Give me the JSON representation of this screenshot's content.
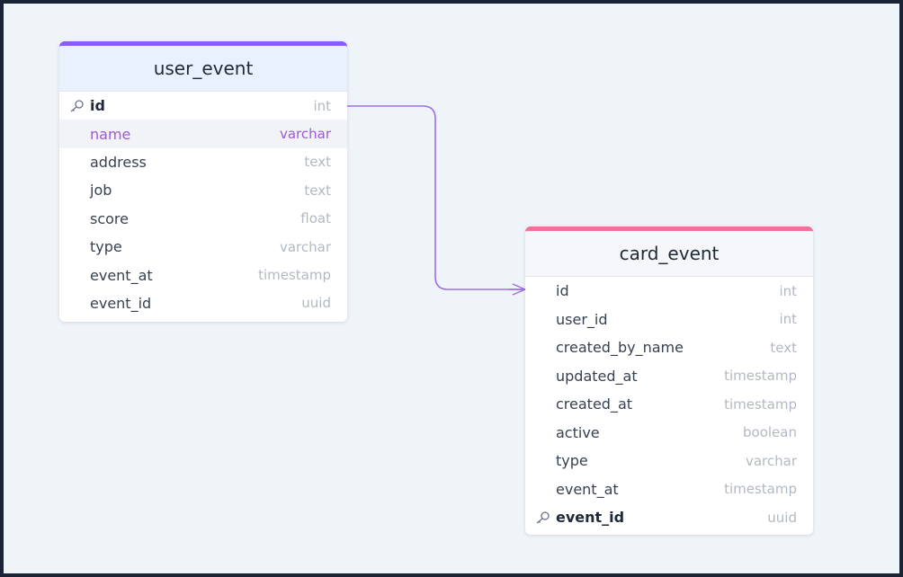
{
  "tables": [
    {
      "name": "user_event",
      "header_color": "#8b5cf6",
      "columns": [
        {
          "name": "id",
          "type": "int",
          "primary_key": true
        },
        {
          "name": "name",
          "type": "varchar",
          "highlighted": true
        },
        {
          "name": "address",
          "type": "text"
        },
        {
          "name": "job",
          "type": "text"
        },
        {
          "name": "score",
          "type": "float"
        },
        {
          "name": "type",
          "type": "varchar"
        },
        {
          "name": "event_at",
          "type": "timestamp"
        },
        {
          "name": "event_id",
          "type": "uuid"
        }
      ]
    },
    {
      "name": "card_event",
      "header_color": "#f0719a",
      "columns": [
        {
          "name": "id",
          "type": "int"
        },
        {
          "name": "user_id",
          "type": "int"
        },
        {
          "name": "created_by_name",
          "type": "text"
        },
        {
          "name": "updated_at",
          "type": "timestamp"
        },
        {
          "name": "created_at",
          "type": "timestamp"
        },
        {
          "name": "active",
          "type": "boolean"
        },
        {
          "name": "type",
          "type": "varchar"
        },
        {
          "name": "event_at",
          "type": "timestamp"
        },
        {
          "name": "event_id",
          "type": "uuid",
          "primary_key": true
        }
      ]
    }
  ],
  "relationship": {
    "from": "user_event.id",
    "to": "card_event.id",
    "cardinality": "one-to-many",
    "color": "#9d6ee8"
  }
}
